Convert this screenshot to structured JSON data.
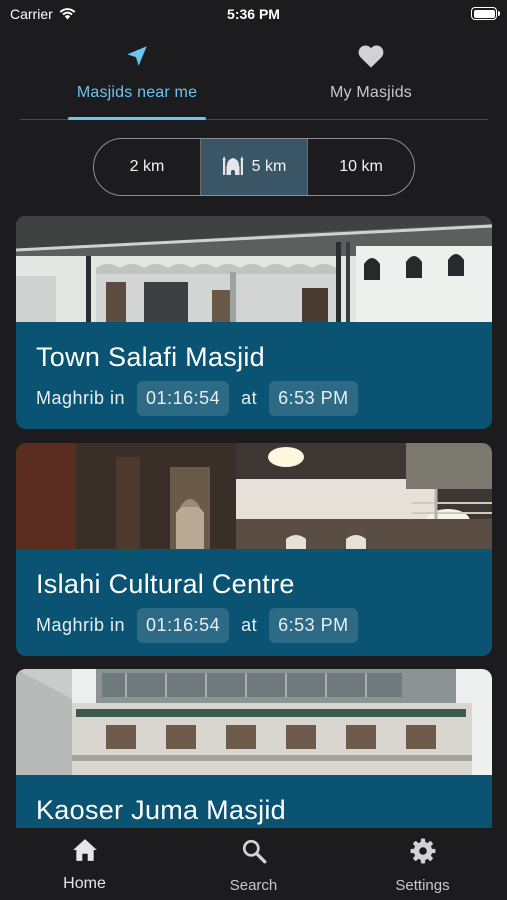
{
  "status": {
    "carrier": "Carrier",
    "time": "5:36 PM",
    "wifi_icon": "wifi-icon",
    "battery_icon": "battery-icon"
  },
  "tabs": [
    {
      "label": "Masjids near me",
      "icon": "location-arrow-icon",
      "active": true
    },
    {
      "label": "My Masjids",
      "icon": "heart-icon",
      "active": false
    }
  ],
  "distance": [
    {
      "label": "2 km",
      "selected": false
    },
    {
      "label": "5 km",
      "selected": true,
      "icon": "mosque-icon"
    },
    {
      "label": "10 km",
      "selected": false
    }
  ],
  "masjids": [
    {
      "name": "Town Salafi Masjid",
      "prayer": "Maghrib in",
      "countdown": "01:16:54",
      "at": "at",
      "time": "6:53 PM"
    },
    {
      "name": "Islahi Cultural Centre",
      "prayer": "Maghrib in",
      "countdown": "01:16:54",
      "at": "at",
      "time": "6:53 PM"
    },
    {
      "name": "Kaoser Juma Masjid"
    }
  ],
  "bottom_nav": [
    {
      "label": "Home",
      "icon": "home-icon",
      "active": true
    },
    {
      "label": "Search",
      "icon": "search-icon",
      "active": false
    },
    {
      "label": "Settings",
      "icon": "gear-icon",
      "active": false
    }
  ],
  "colors": {
    "accent": "#6cc4f0",
    "card": "#0b5372",
    "pill": "#2d6a86",
    "background": "#1c1c1e",
    "segment_selected": "#3a5566"
  }
}
